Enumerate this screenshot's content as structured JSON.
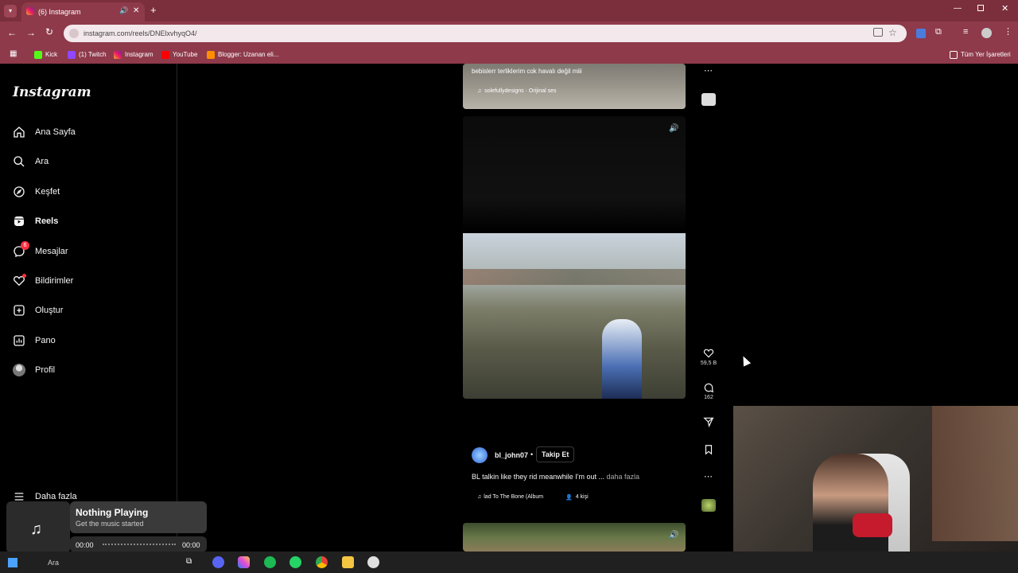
{
  "browser": {
    "tab_title": "(6) Instagram",
    "url": "instagram.com/reels/DNElxvhyqO4/",
    "bookmarks": [
      "Kick",
      "(1) Twitch",
      "Instagram",
      "YouTube",
      "Blogger: Uzanan eli...",
      "Tüm Yer İşaretleri"
    ]
  },
  "sidebar": {
    "logo": "Instagram",
    "items": [
      {
        "label": "Ana Sayfa",
        "icon": "home-icon"
      },
      {
        "label": "Ara",
        "icon": "search-icon"
      },
      {
        "label": "Keşfet",
        "icon": "compass-icon"
      },
      {
        "label": "Reels",
        "icon": "reels-icon"
      },
      {
        "label": "Mesajlar",
        "icon": "messenger-icon",
        "badge": "6"
      },
      {
        "label": "Bildirimler",
        "icon": "heart-icon"
      },
      {
        "label": "Oluştur",
        "icon": "plus-square-icon"
      },
      {
        "label": "Pano",
        "icon": "chart-icon"
      },
      {
        "label": "Profil",
        "icon": "avatar-icon"
      }
    ],
    "more": "Daha fazla"
  },
  "reel_top": {
    "caption": "bebislerr terliklerim cok havalı değil miii",
    "audio": "solefullydesigns · Orijinal ses"
  },
  "reel_main": {
    "likes": "59,5 B",
    "comments": "162",
    "username": "bl_john07",
    "follow": "Takip Et",
    "caption": "BL talkin like they rid meanwhile I'm out ...",
    "more": "daha fazla",
    "audio": "lad To The Bone (Album",
    "people": "4 kişi"
  },
  "music_widget": {
    "title": "Nothing Playing",
    "subtitle": "Get the music started",
    "time_start": "00:00",
    "time_end": "00:00"
  },
  "taskbar": {
    "search": "Ara"
  },
  "colors": {
    "browser_frame": "#8e3a4b",
    "tab_bar": "#7b2e3c",
    "background": "#000000",
    "notification": "#ff3040"
  }
}
